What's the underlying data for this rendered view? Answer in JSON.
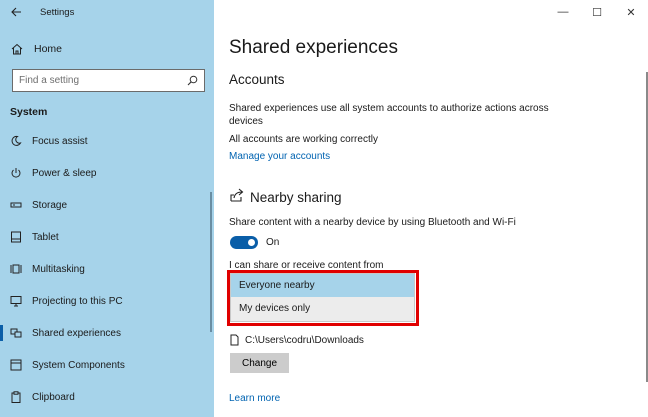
{
  "window": {
    "title": "Settings",
    "controls": {
      "minimize": "—",
      "maximize": "☐",
      "close": "✕"
    }
  },
  "sidebar": {
    "home_label": "Home",
    "search_placeholder": "Find a setting",
    "section": "System",
    "items": [
      {
        "label": "Focus assist",
        "icon": "moon-icon"
      },
      {
        "label": "Power & sleep",
        "icon": "power-icon"
      },
      {
        "label": "Storage",
        "icon": "storage-icon"
      },
      {
        "label": "Tablet",
        "icon": "tablet-icon"
      },
      {
        "label": "Multitasking",
        "icon": "multitasking-icon"
      },
      {
        "label": "Projecting to this PC",
        "icon": "projector-icon"
      },
      {
        "label": "Shared experiences",
        "icon": "shared-icon",
        "active": true
      },
      {
        "label": "System Components",
        "icon": "components-icon"
      },
      {
        "label": "Clipboard",
        "icon": "clipboard-icon"
      }
    ]
  },
  "main": {
    "title": "Shared experiences",
    "accounts": {
      "heading": "Accounts",
      "desc_line1": "Shared experiences use all system accounts to authorize actions across",
      "desc_line2": "devices",
      "status": "All accounts are working correctly",
      "manage_link": "Manage your accounts"
    },
    "nearby": {
      "heading": "Nearby sharing",
      "desc": "Share content with a nearby device by using Bluetooth and Wi-Fi",
      "toggle_label": "On",
      "share_from_label": "I can share or receive content from",
      "options": [
        "Everyone nearby",
        "My devices only"
      ],
      "selected_option": "Everyone nearby",
      "folder_path": "C:\\Users\\codru\\Downloads",
      "change_button": "Change"
    },
    "learn_more": "Learn more"
  },
  "colors": {
    "sidebar_bg": "#a6d3ea",
    "accent": "#0a5ea8",
    "link": "#0063b1",
    "highlight": "#e00000"
  }
}
